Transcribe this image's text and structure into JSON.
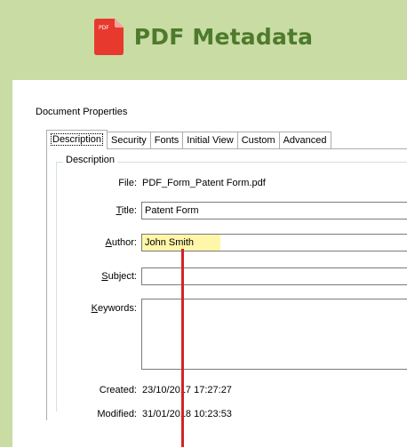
{
  "header": {
    "icon_name": "pdf-file-icon",
    "icon_text": "PDF",
    "title": "PDF Metadata",
    "accent_color": "#4e7a2c",
    "background_color": "#c8dca4"
  },
  "dialog": {
    "title": "Document Properties",
    "tabs": [
      {
        "label": "Description",
        "active": true
      },
      {
        "label": "Security",
        "active": false
      },
      {
        "label": "Fonts",
        "active": false
      },
      {
        "label": "Initial View",
        "active": false
      },
      {
        "label": "Custom",
        "active": false
      },
      {
        "label": "Advanced",
        "active": false
      }
    ],
    "group_label": "Description",
    "file": {
      "label": "File:",
      "value": "PDF_Form_Patent Form.pdf"
    },
    "title_field": {
      "label_prefix": "",
      "label_key": "T",
      "label_rest": "itle:",
      "value": "Patent Form"
    },
    "author_field": {
      "label_key": "A",
      "label_rest": "uthor:",
      "value": "John Smith",
      "highlight_color": "#fff59a"
    },
    "subject_field": {
      "label_key": "S",
      "label_rest": "ubject:",
      "value": ""
    },
    "keywords_field": {
      "label_key": "K",
      "label_rest": "eywords:",
      "value": ""
    },
    "created": {
      "label": "Created:",
      "value": "23/10/2017 17:27:27"
    },
    "modified": {
      "label": "Modified:",
      "value": "31/01/2018 10:23:53"
    },
    "callout_color": "#d02525"
  }
}
